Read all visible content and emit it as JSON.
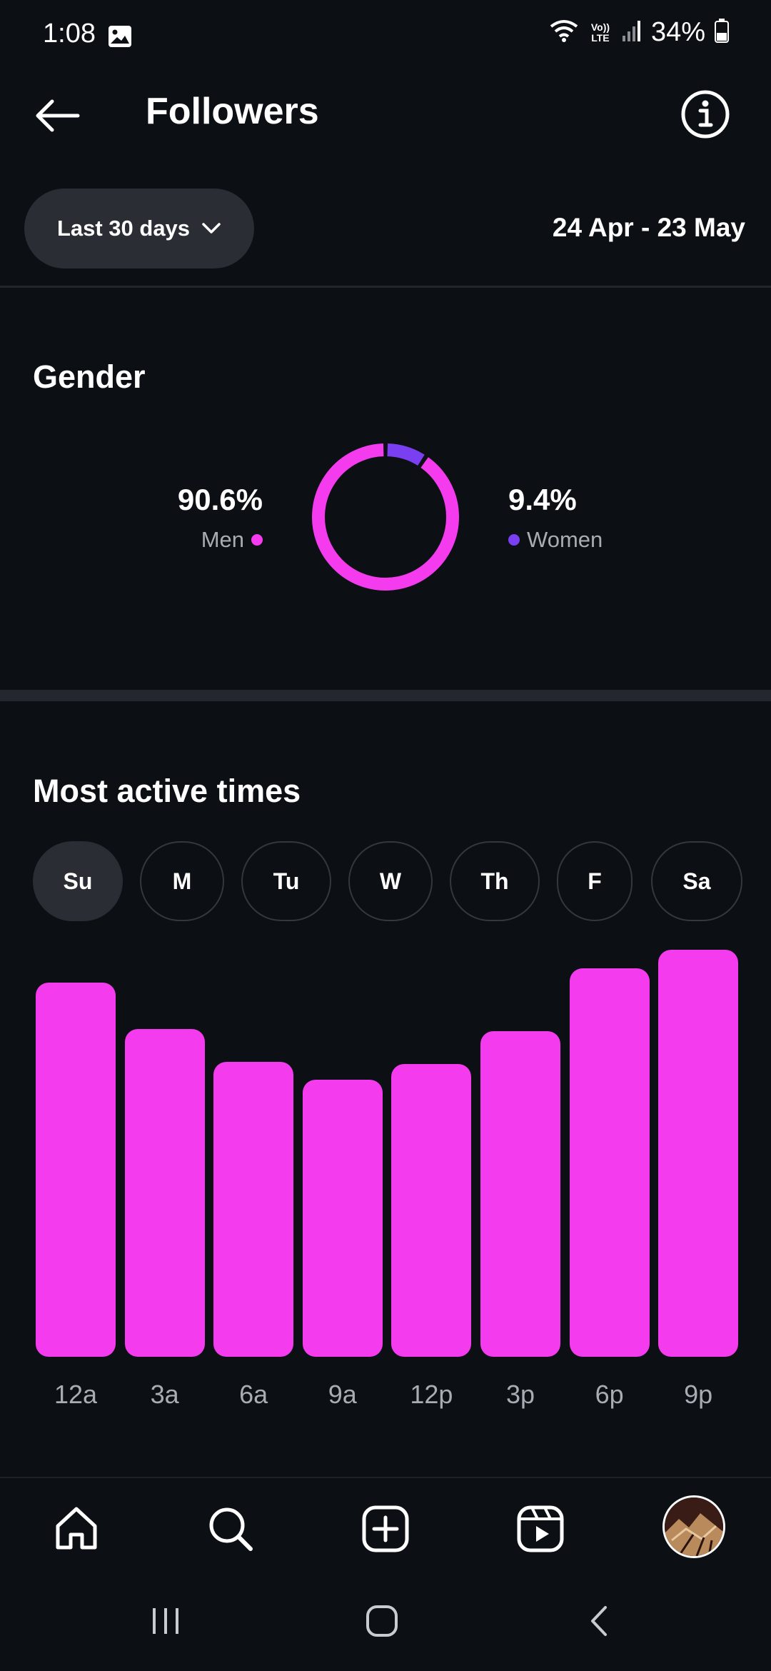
{
  "status_bar": {
    "time": "1:08",
    "network_label": "Vo)) LTE",
    "battery": "34%"
  },
  "header": {
    "title": "Followers",
    "back_icon": "arrow-left-icon",
    "info_icon": "info-circle-icon"
  },
  "filter": {
    "range_label": "Last 30 days",
    "date_range": "24 Apr - 23 May"
  },
  "gender": {
    "title": "Gender",
    "men": {
      "percent": "90.6%",
      "label": "Men",
      "color": "#f43cee"
    },
    "women": {
      "percent": "9.4%",
      "label": "Women",
      "color": "#7b3ff2"
    }
  },
  "active_times": {
    "title": "Most active times",
    "days": [
      "Su",
      "M",
      "Tu",
      "W",
      "Th",
      "F",
      "Sa"
    ],
    "selected_day": "Su"
  },
  "chart_data": [
    {
      "type": "pie",
      "title": "Gender",
      "categories": [
        "Men",
        "Women"
      ],
      "values": [
        90.6,
        9.4
      ],
      "colors": [
        "#f43cee",
        "#7b3ff2"
      ]
    },
    {
      "type": "bar",
      "title": "Most active times",
      "categories": [
        "12a",
        "3a",
        "6a",
        "9a",
        "12p",
        "3p",
        "6p",
        "9p"
      ],
      "values": [
        92,
        80.5,
        72.5,
        68,
        72,
        80,
        95.5,
        100
      ],
      "ylim": [
        0,
        100
      ],
      "color": "#f43cee",
      "grid": false
    }
  ],
  "colors": {
    "accent": "#f43cee",
    "secondary": "#7b3ff2",
    "background": "#0c0f14",
    "surface": "#2a2d33"
  },
  "bottom_nav": {
    "items": [
      "home-icon",
      "search-icon",
      "create-post-icon",
      "reels-icon",
      "profile-avatar"
    ]
  },
  "system_nav": {
    "items": [
      "recent-apps-icon",
      "home-circle-icon",
      "back-chevron-icon"
    ]
  }
}
